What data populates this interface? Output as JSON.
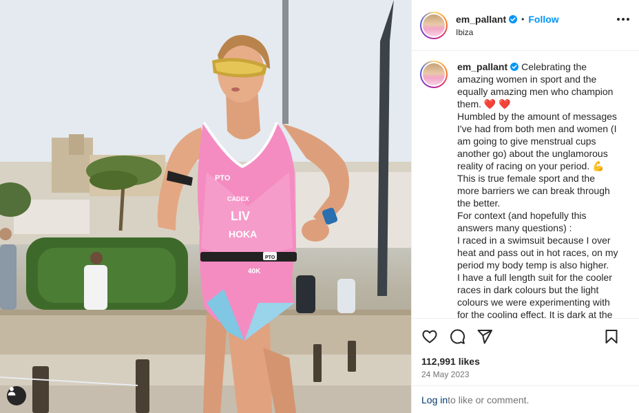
{
  "post": {
    "author": "em_pallant",
    "location": "Ibiza",
    "follow_label": "Follow",
    "dot": "•",
    "caption_lines": [
      "Celebrating the amazing women in sport and the equally amazing men who champion them. ❤️ ❤️",
      "Humbled by the amount of messages I've had from both men and women (I am going to give menstrual cups another go) about the unglamorous reality of racing on your period. 💪",
      "This is true female sport and the more barriers we can break through the better.",
      "For context (and hopefully this answers many questions) :",
      "I raced in a swimsuit because I over heat and pass out in hot races, on my period my body temp is also higher.",
      "I have a full length suit for the cooler races in dark colours but the light colours we were experimenting with for the cooling effect. It is dark at the"
    ],
    "likes": "112,991 likes",
    "date": "24 May 2023",
    "login_link": "Log in",
    "login_suffix": " to like or comment."
  },
  "photo": {
    "suit_text": [
      "PTO",
      "CADEX",
      "LIV",
      "HOKA",
      "PTO",
      "40K"
    ]
  },
  "icons": {
    "verified": "verified-badge-icon",
    "more": "more-options-icon",
    "like": "heart-icon",
    "comment": "comment-bubble-icon",
    "share": "paper-plane-icon",
    "save": "bookmark-icon",
    "user_tag": "user-tag-icon"
  },
  "colors": {
    "follow": "#0095f6",
    "suit_pink": "#f48cc2",
    "verified": "#0095f6"
  }
}
